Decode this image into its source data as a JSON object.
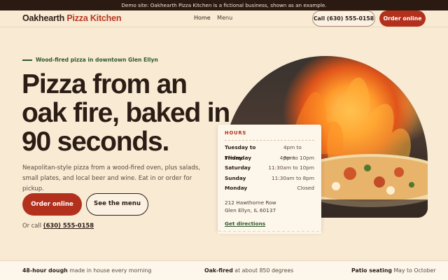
{
  "banner": "Demo site: Oakhearth Pizza Kitchen is a fictional business, shown as an example.",
  "header": {
    "logo_main": "Oakhearth",
    "logo_accent": "Pizza Kitchen",
    "nav": [
      "Home",
      "Menu"
    ],
    "call_button": "Call (630) 555-0158",
    "order_button": "Order online"
  },
  "hero": {
    "eyebrow": "Wood-fired pizza in downtown Glen Ellyn",
    "headline": "Pizza from an oak fire, baked in 90 seconds.",
    "lede": "Neapolitan-style pizza from a wood-fired oven, plus salads, small plates, and local beer and wine. Eat in or order for pickup.",
    "order_button": "Order online",
    "menu_button": "See the menu",
    "or_call_prefix": "Or call",
    "phone": "(630) 555-0158"
  },
  "hours_card": {
    "title": "HOURS",
    "rows": [
      {
        "day": "Tuesday to Thursday",
        "time": "4pm to 9pm"
      },
      {
        "day": "Friday",
        "time": "4pm to 10pm"
      },
      {
        "day": "Saturday",
        "time": "11:30am to 10pm"
      },
      {
        "day": "Sunday",
        "time": "11:30am to 8pm"
      },
      {
        "day": "Monday",
        "time": "Closed"
      }
    ],
    "address_line1": "212 Hawthorne Row",
    "address_line2": "Glen Ellyn, IL 60137",
    "directions": "Get directions"
  },
  "features": [
    {
      "bold": "48-hour dough",
      "rest": " made in house every morning"
    },
    {
      "bold": "Oak-fired",
      "rest": " at about 850 degrees"
    },
    {
      "bold": "Patio seating",
      "rest": " May to October"
    }
  ],
  "colors": {
    "brand_red": "#b3311c",
    "accent_green": "#2f5a2d",
    "background": "#f8ead3",
    "ink": "#2b1d15"
  }
}
